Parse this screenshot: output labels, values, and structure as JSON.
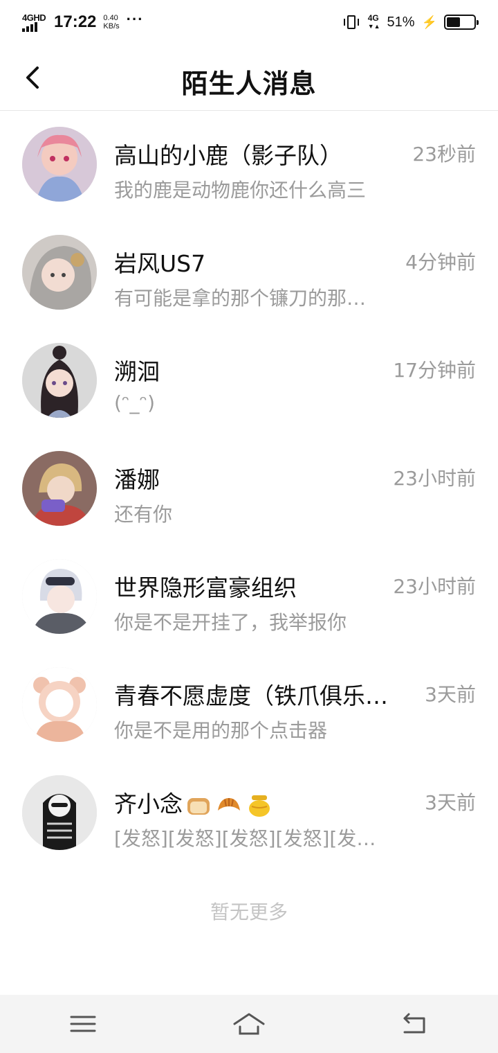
{
  "status_bar": {
    "network": "4GHD",
    "time": "17:22",
    "speed_value": "0.40",
    "speed_unit": "KB/s",
    "dots": "···",
    "net_type": "4G",
    "battery_percent": "51%",
    "battery_level": 0.51
  },
  "header": {
    "title": "陌生人消息",
    "back_icon": "chevron-left-icon"
  },
  "messages": [
    {
      "name": "高山的小鹿（影子队）",
      "time": "23秒前",
      "preview": "我的鹿是动物鹿你还什么高三",
      "avatar_color": "#c9a7c9"
    },
    {
      "name": "岩风US7",
      "time": "4分钟前",
      "preview": "有可能是拿的那个镰刀的那…",
      "avatar_color": "#b9b2ad"
    },
    {
      "name": "溯洄",
      "time": "17分钟前",
      "preview": "(ᵔ_ᵔ)",
      "avatar_color": "#6b5b6e"
    },
    {
      "name": "潘娜",
      "time": "23小时前",
      "preview": "还有你",
      "avatar_color": "#a86f5a"
    },
    {
      "name": "世界隐形富豪组织",
      "time": "23小时前",
      "preview": "你是不是开挂了，我举报你",
      "avatar_color": "#9aa3b5"
    },
    {
      "name": "青春不愿虚度（铁爪俱乐…",
      "time": "3天前",
      "preview": "你是不是用的那个点击器",
      "avatar_color": "#e6b7a1"
    },
    {
      "name": "齐小念",
      "time": "3天前",
      "preview": "[发怒][发怒][发怒][发怒][发怒]…",
      "avatar_color": "#333333"
    }
  ],
  "footer_text": "暂无更多",
  "navbar": {
    "menu_icon": "menu-icon",
    "home_icon": "home-icon",
    "back_icon": "back-arrow-icon"
  }
}
